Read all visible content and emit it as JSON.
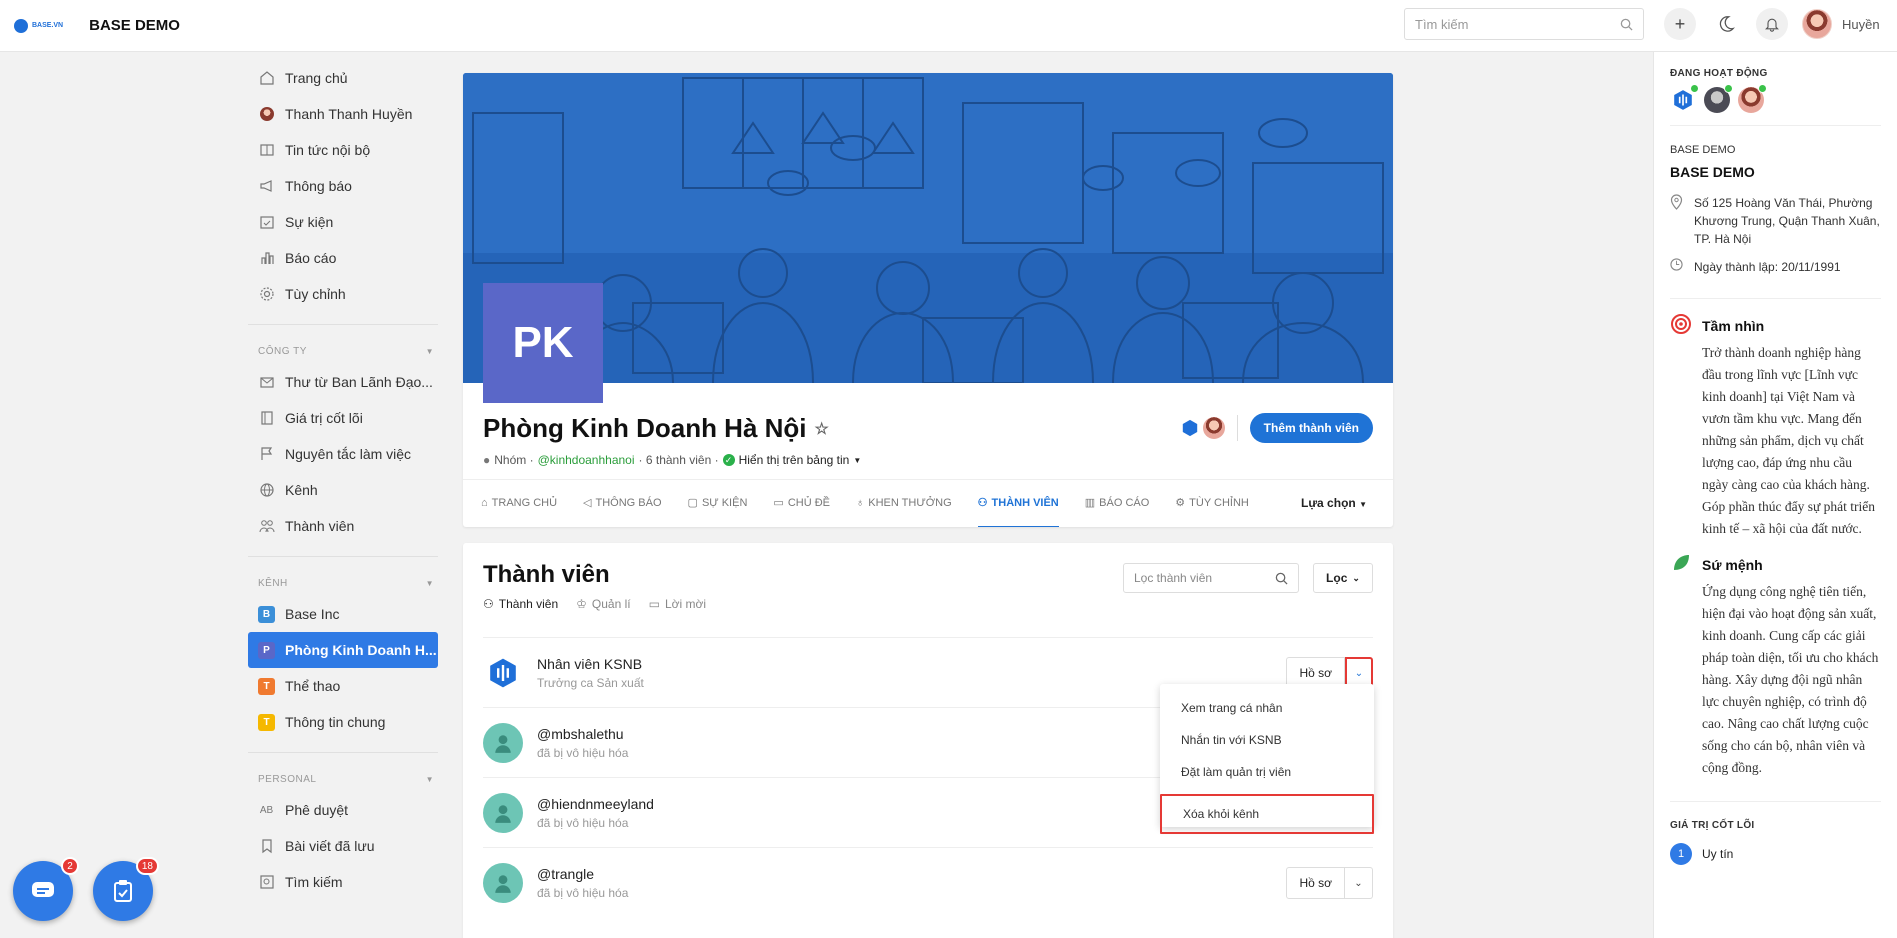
{
  "topbar": {
    "logo_text": "BASE.VN",
    "brand": "BASE DEMO",
    "search_placeholder": "Tìm kiếm",
    "user_name": "Huyền"
  },
  "nav": {
    "main": [
      {
        "label": "Trang chủ",
        "icon": "home-icon"
      },
      {
        "label": "Thanh Thanh Huyền",
        "icon": "avatar"
      },
      {
        "label": "Tin tức nội bộ",
        "icon": "newspaper-icon"
      },
      {
        "label": "Thông báo",
        "icon": "megaphone-icon"
      },
      {
        "label": "Sự kiện",
        "icon": "calendar-icon"
      },
      {
        "label": "Báo cáo",
        "icon": "chart-icon"
      },
      {
        "label": "Tùy chỉnh",
        "icon": "gear-icon"
      }
    ],
    "company_header": "CÔNG TY",
    "company": [
      {
        "label": "Thư từ Ban Lãnh Đạo...",
        "icon": "mail-icon"
      },
      {
        "label": "Giá trị cốt lõi",
        "icon": "book-icon"
      },
      {
        "label": "Nguyên tắc làm việc",
        "icon": "flag-icon"
      },
      {
        "label": "Kênh",
        "icon": "globe-icon"
      },
      {
        "label": "Thành viên",
        "icon": "users-icon"
      }
    ],
    "channel_header": "KÊNH",
    "channels": [
      {
        "letter": "B",
        "label": "Base Inc",
        "color": "#3b8fd8"
      },
      {
        "letter": "P",
        "label": "Phòng Kinh Doanh H...",
        "color": "#5a67c8"
      },
      {
        "letter": "T",
        "label": "Thể thao",
        "color": "#f07a30"
      },
      {
        "letter": "T",
        "label": "Thông tin chung",
        "color": "#f5b800"
      }
    ],
    "personal_header": "PERSONAL",
    "personal": [
      {
        "label": "Phê duyệt",
        "icon": "approve-icon"
      },
      {
        "label": "Bài viết đã lưu",
        "icon": "bookmark-icon"
      },
      {
        "label": "Tìm kiếm",
        "icon": "search-icon"
      }
    ]
  },
  "group": {
    "initials": "PK",
    "title": "Phòng Kinh Doanh Hà Nội",
    "meta_type": "Nhóm ·",
    "meta_handle": "@kinhdoanhhanoi",
    "meta_count": "· 6 thành viên ·",
    "meta_visibility": "Hiển thị trên bảng tin",
    "add_member": "Thêm thành viên"
  },
  "tabs": [
    {
      "label": "TRANG CHỦ",
      "icon": "home-icon"
    },
    {
      "label": "THÔNG BÁO",
      "icon": "megaphone-icon"
    },
    {
      "label": "SỰ KIỆN",
      "icon": "calendar-icon"
    },
    {
      "label": "CHỦ ĐỀ",
      "icon": "chat-icon"
    },
    {
      "label": "KHEN THƯỞNG",
      "icon": "award-icon"
    },
    {
      "label": "THÀNH VIÊN",
      "icon": "users-icon"
    },
    {
      "label": "BÁO CÁO",
      "icon": "chart-icon"
    },
    {
      "label": "TÙY CHỈNH",
      "icon": "gear-icon"
    }
  ],
  "tabs_more": "Lựa chọn",
  "members": {
    "title": "Thành viên",
    "subtabs": [
      "Thành viên",
      "Quản lí",
      "Lời mời"
    ],
    "filter_placeholder": "Lọc thành viên",
    "filter_button": "Lọc",
    "profile_label": "Hồ sơ",
    "rows": [
      {
        "name": "Nhân viên KSNB",
        "sub": "Trưởng ca Sản xuất"
      },
      {
        "name": "@mbshalethu",
        "sub": "đã bị vô hiệu hóa"
      },
      {
        "name": "@hiendnmeeyland",
        "sub": "đã bị vô hiệu hóa"
      },
      {
        "name": "@trangle",
        "sub": "đã bị vô hiệu hóa"
      }
    ]
  },
  "dropdown": [
    "Xem trang cá nhân",
    "Nhắn tin với KSNB",
    "Đặt làm quản trị viên",
    "Xóa khỏi kênh"
  ],
  "right": {
    "active_title": "ĐANG HOẠT ĐỘNG",
    "company_small": "BASE DEMO",
    "company_big": "BASE DEMO",
    "address": "Số 125 Hoàng Văn Thái, Phường Khương Trung, Quận Thanh Xuân, TP. Hà Nội",
    "founded": "Ngày thành lập: 20/11/1991",
    "vision_title": "Tầm nhìn",
    "vision_text": "Trở thành doanh nghiệp hàng đầu trong lĩnh vực [Lĩnh vực kinh doanh] tại Việt Nam và vươn tầm khu vực. Mang đến những sản phẩm, dịch vụ chất lượng cao, đáp ứng nhu cầu ngày càng cao của khách hàng. Góp phần thúc đẩy sự phát triển kinh tế – xã hội của đất nước.",
    "mission_title": "Sứ mệnh",
    "mission_text": "Ứng dụng công nghệ tiên tiến, hiện đại vào hoạt động sản xuất, kinh doanh. Cung cấp các giải pháp toàn diện, tối ưu cho khách hàng. Xây dựng đội ngũ nhân lực chuyên nghiệp, có trình độ cao. Nâng cao chất lượng cuộc sống cho cán bộ, nhân viên và cộng đồng.",
    "values_title": "GIÁ TRỊ CỐT LÕI",
    "value_1_num": "1",
    "value_1": "Uy tín"
  },
  "fabs": {
    "chat_badge": "2",
    "task_badge": "18"
  },
  "colors": {
    "accent": "#2f7ae5",
    "danger": "#e53935",
    "cover": "#2d6fc4"
  }
}
